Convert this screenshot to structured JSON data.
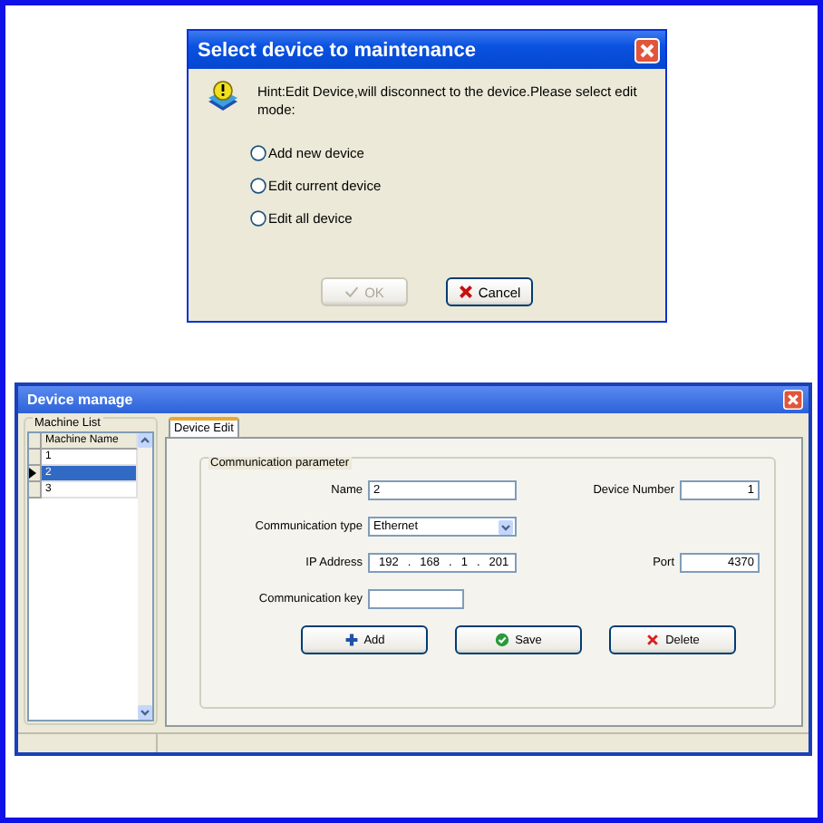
{
  "dialog": {
    "title": "Select device to maintenance",
    "hint": "Hint:Edit Device,will disconnect to the device.Please select edit mode:",
    "options": [
      {
        "label": "Add new device",
        "selected": false
      },
      {
        "label": "Edit current device",
        "selected": false
      },
      {
        "label": "Edit all device",
        "selected": false
      }
    ],
    "buttons": [
      {
        "label": "OK",
        "kind": "ok",
        "disabled": true
      },
      {
        "label": "Cancel",
        "kind": "cancel",
        "disabled": false
      }
    ]
  },
  "window": {
    "title": "Device manage",
    "machine_list": {
      "title": "Machine List",
      "column": "Machine Name",
      "rows": [
        {
          "name": "1",
          "selected": false
        },
        {
          "name": "2",
          "selected": true
        },
        {
          "name": "3",
          "selected": false
        }
      ]
    },
    "tabs": [
      {
        "label": "Device Edit",
        "selected": true
      }
    ],
    "group": {
      "title": "Communication parameter",
      "name": {
        "label": "Name",
        "value": "2"
      },
      "device_number": {
        "label": "Device Number",
        "value": "1"
      },
      "comm_type": {
        "label": "Communication type",
        "value": "Ethernet"
      },
      "ip": {
        "label": "IP Address",
        "octets": [
          "192",
          "168",
          "1",
          "201"
        ],
        "separator": "."
      },
      "port": {
        "label": "Port",
        "value": "4370"
      },
      "comm_key": {
        "label": "Communication key"
      }
    },
    "buttons": [
      {
        "label": "Add",
        "kind": "add"
      },
      {
        "label": "Save",
        "kind": "save"
      },
      {
        "label": "Delete",
        "kind": "delete"
      }
    ]
  }
}
